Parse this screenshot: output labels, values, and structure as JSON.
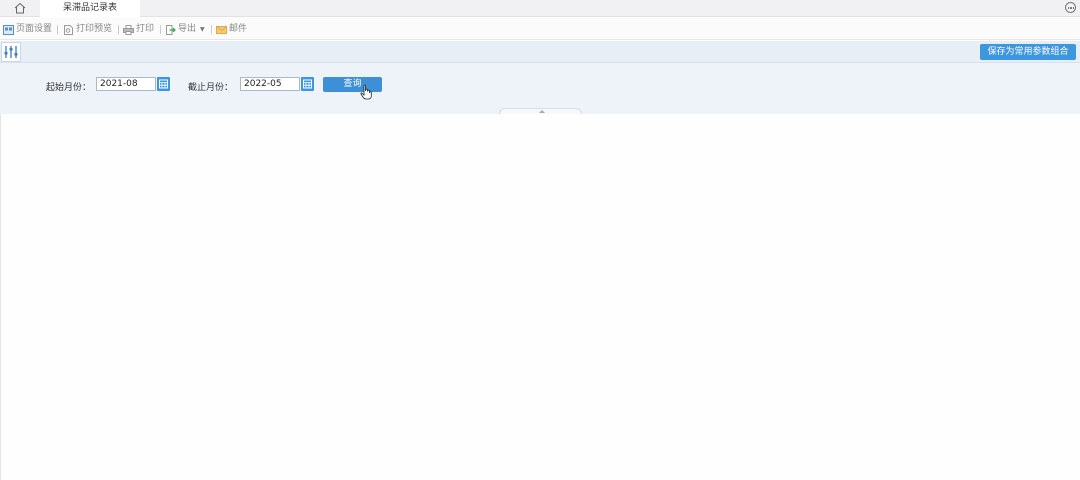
{
  "tabbar": {
    "home_icon": "home-icon",
    "active_tab": "呆滞品记录表",
    "more_icon": "more-icon"
  },
  "toolbar": {
    "page_setup": "页面设置",
    "print_preview": "打印预览",
    "print": "打印",
    "export": "导出",
    "mail": "邮件"
  },
  "filter_header": {
    "filter_icon": "sliders-icon",
    "save_button": "保存为常用参数组合"
  },
  "query": {
    "start_label": "起始月份：",
    "start_value": "2021-08",
    "end_label": "截止月份：",
    "end_value": "2022-05",
    "query_button": "查询"
  },
  "colors": {
    "accent": "#3d96e0",
    "panel_bg": "#eef3fa"
  }
}
